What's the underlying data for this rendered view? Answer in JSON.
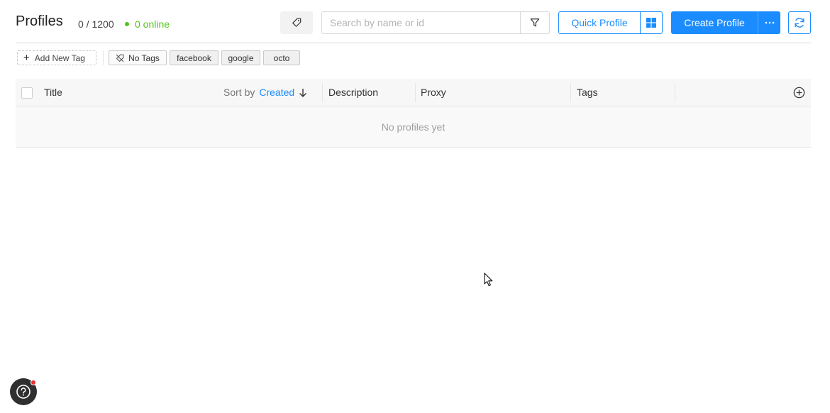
{
  "header": {
    "title": "Profiles",
    "count": "0 / 1200",
    "online": "0 online"
  },
  "search": {
    "placeholder": "Search by name or id",
    "value": ""
  },
  "buttons": {
    "quick_profile": "Quick Profile",
    "create_profile": "Create Profile"
  },
  "tags": {
    "add_new": "Add New Tag",
    "no_tags": "No Tags",
    "items": [
      "facebook",
      "google",
      "octo"
    ]
  },
  "table": {
    "columns": {
      "title": "Title",
      "sort_by": "Sort by",
      "sort_field": "Created",
      "description": "Description",
      "proxy": "Proxy",
      "tags": "Tags"
    },
    "empty_text": "No profiles yet"
  },
  "colors": {
    "accent": "#1a8cff",
    "online": "#52c41a",
    "notification": "#e8322f"
  },
  "icons": [
    "tag-icon",
    "filter-icon",
    "windows-icon",
    "more-icon",
    "refresh-icon",
    "plus-icon",
    "no-tags-icon",
    "sort-arrow-down-icon",
    "add-column-icon",
    "help-icon",
    "cursor-icon"
  ]
}
